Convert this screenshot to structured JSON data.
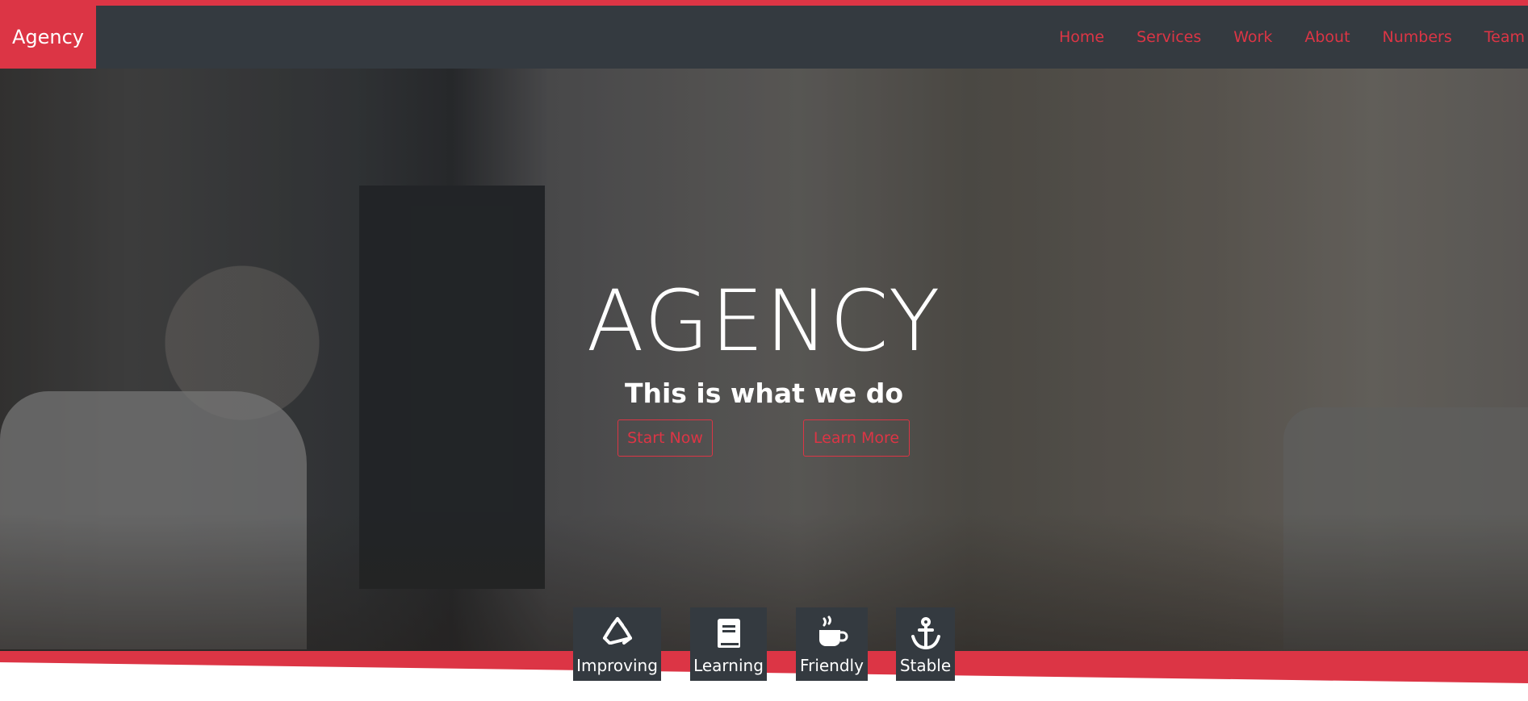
{
  "navbar": {
    "brand": "Agency",
    "links": [
      "Home",
      "Services",
      "Work",
      "About",
      "Numbers",
      "Team"
    ]
  },
  "hero": {
    "title": "AGENCY",
    "subtitle": "This is what we do",
    "buttons": {
      "start": "Start Now",
      "learn": "Learn More"
    }
  },
  "features": [
    {
      "label": "Improving",
      "icon": "recycle-icon"
    },
    {
      "label": "Learning",
      "icon": "book-icon"
    },
    {
      "label": "Friendly",
      "icon": "coffee-icon"
    },
    {
      "label": "Stable",
      "icon": "anchor-icon"
    }
  ],
  "colors": {
    "accent": "#dc3545",
    "dark": "#343a40",
    "text_light": "#ffffff"
  }
}
